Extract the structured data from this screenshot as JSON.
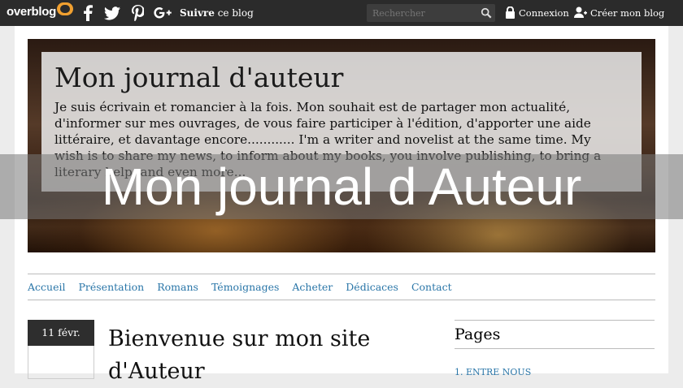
{
  "topbar": {
    "logo": "overblog",
    "social": [
      {
        "icon": "facebook-icon",
        "glyph": "f"
      },
      {
        "icon": "twitter-icon",
        "glyph": "t"
      },
      {
        "icon": "pinterest-icon",
        "glyph": "P"
      },
      {
        "icon": "google-plus-icon",
        "glyph": "g+"
      }
    ],
    "follow_bold": "Suivre",
    "follow_rest": " ce blog",
    "search_placeholder": "Rechercher",
    "login": "Connexion",
    "create": "Créer mon blog"
  },
  "banner": {
    "title": "Mon journal d'auteur",
    "description": "Je suis écrivain et romancier à la fois. Mon souhait est de partager mon actualité, d'informer sur mes ouvrages, de vous faire participer à l'édition, d'apporter une aide littéraire, et davantage encore............ I'm a writer and novelist at the same time. My wish is to share my news, to inform about my books, you involve publishing, to bring a literary help, and even more..."
  },
  "overlay_title": "Mon journal d Auteur",
  "nav": [
    "Accueil",
    "Présentation",
    "Romans",
    "Témoignages",
    "Acheter",
    "Dédicaces",
    "Contact"
  ],
  "post": {
    "date": "11 févr.",
    "title": "Bienvenue sur mon site d'Auteur"
  },
  "sidebar": {
    "title": "Pages",
    "first_item": "1. ENTRE NOUS"
  },
  "colors": {
    "topbar": "#2b2b2b",
    "link": "#2a76a8",
    "logo_accent": "#f0a030"
  }
}
